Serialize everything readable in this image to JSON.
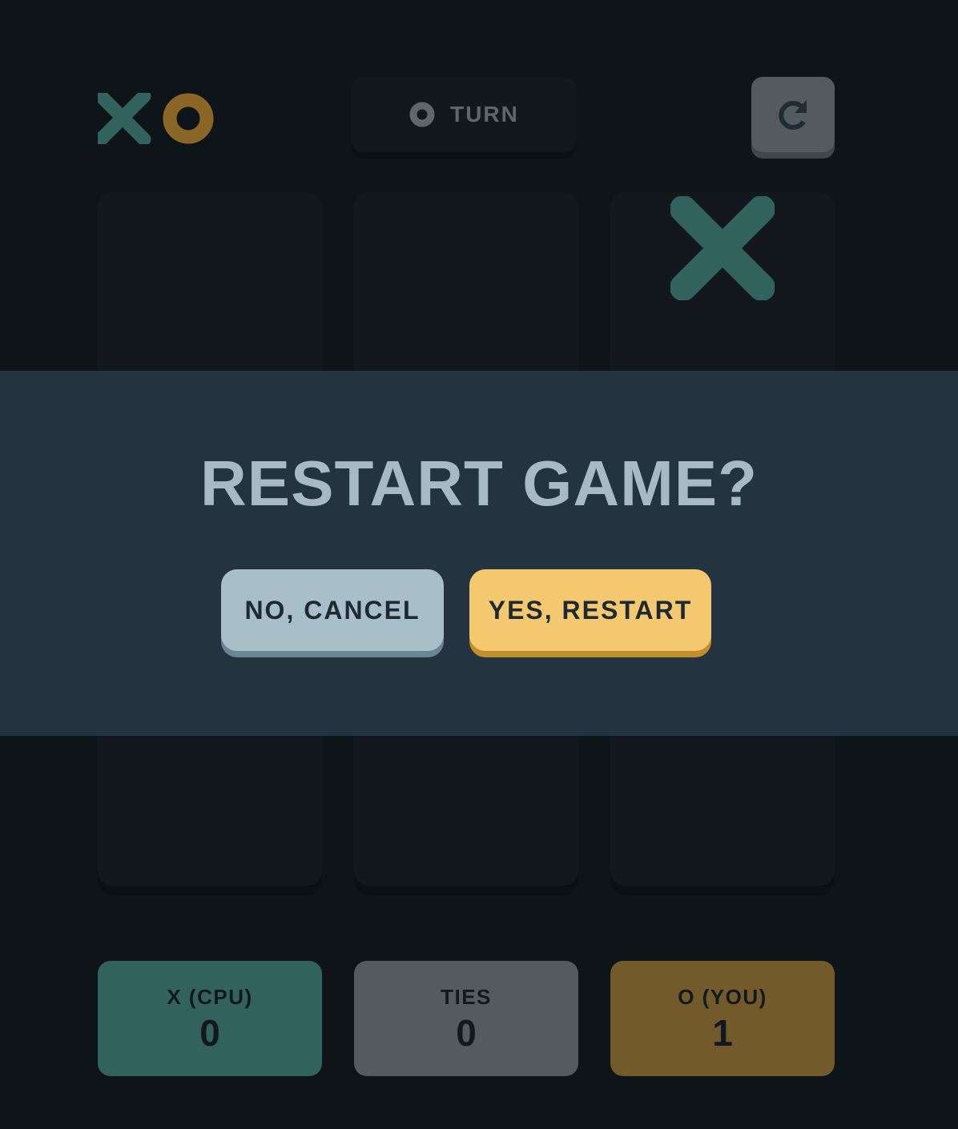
{
  "header": {
    "logo_icons": [
      "x-mark-icon",
      "o-mark-icon"
    ],
    "turn": {
      "current_player_icon": "o-mark-icon",
      "label": "TURN"
    },
    "restart_icon": "restart-arrow-icon"
  },
  "board": {
    "cells": [
      "",
      "",
      "X",
      "",
      "",
      "",
      "",
      "",
      ""
    ]
  },
  "scores": [
    {
      "label": "X (CPU)",
      "value": "0",
      "color": "#31625e"
    },
    {
      "label": "TIES",
      "value": "0",
      "color": "#535a60"
    },
    {
      "label": "O (YOU)",
      "value": "1",
      "color": "#725a2a"
    }
  ],
  "modal": {
    "title": "RESTART GAME?",
    "cancel_label": "NO, CANCEL",
    "confirm_label": "YES, RESTART"
  },
  "colors": {
    "background": "#0e1518",
    "x_mark": "#31625e",
    "o_mark": "#8a6627",
    "modal_bg": "#233440",
    "cancel_btn": "#a8bfca",
    "confirm_btn": "#f4c86e"
  }
}
